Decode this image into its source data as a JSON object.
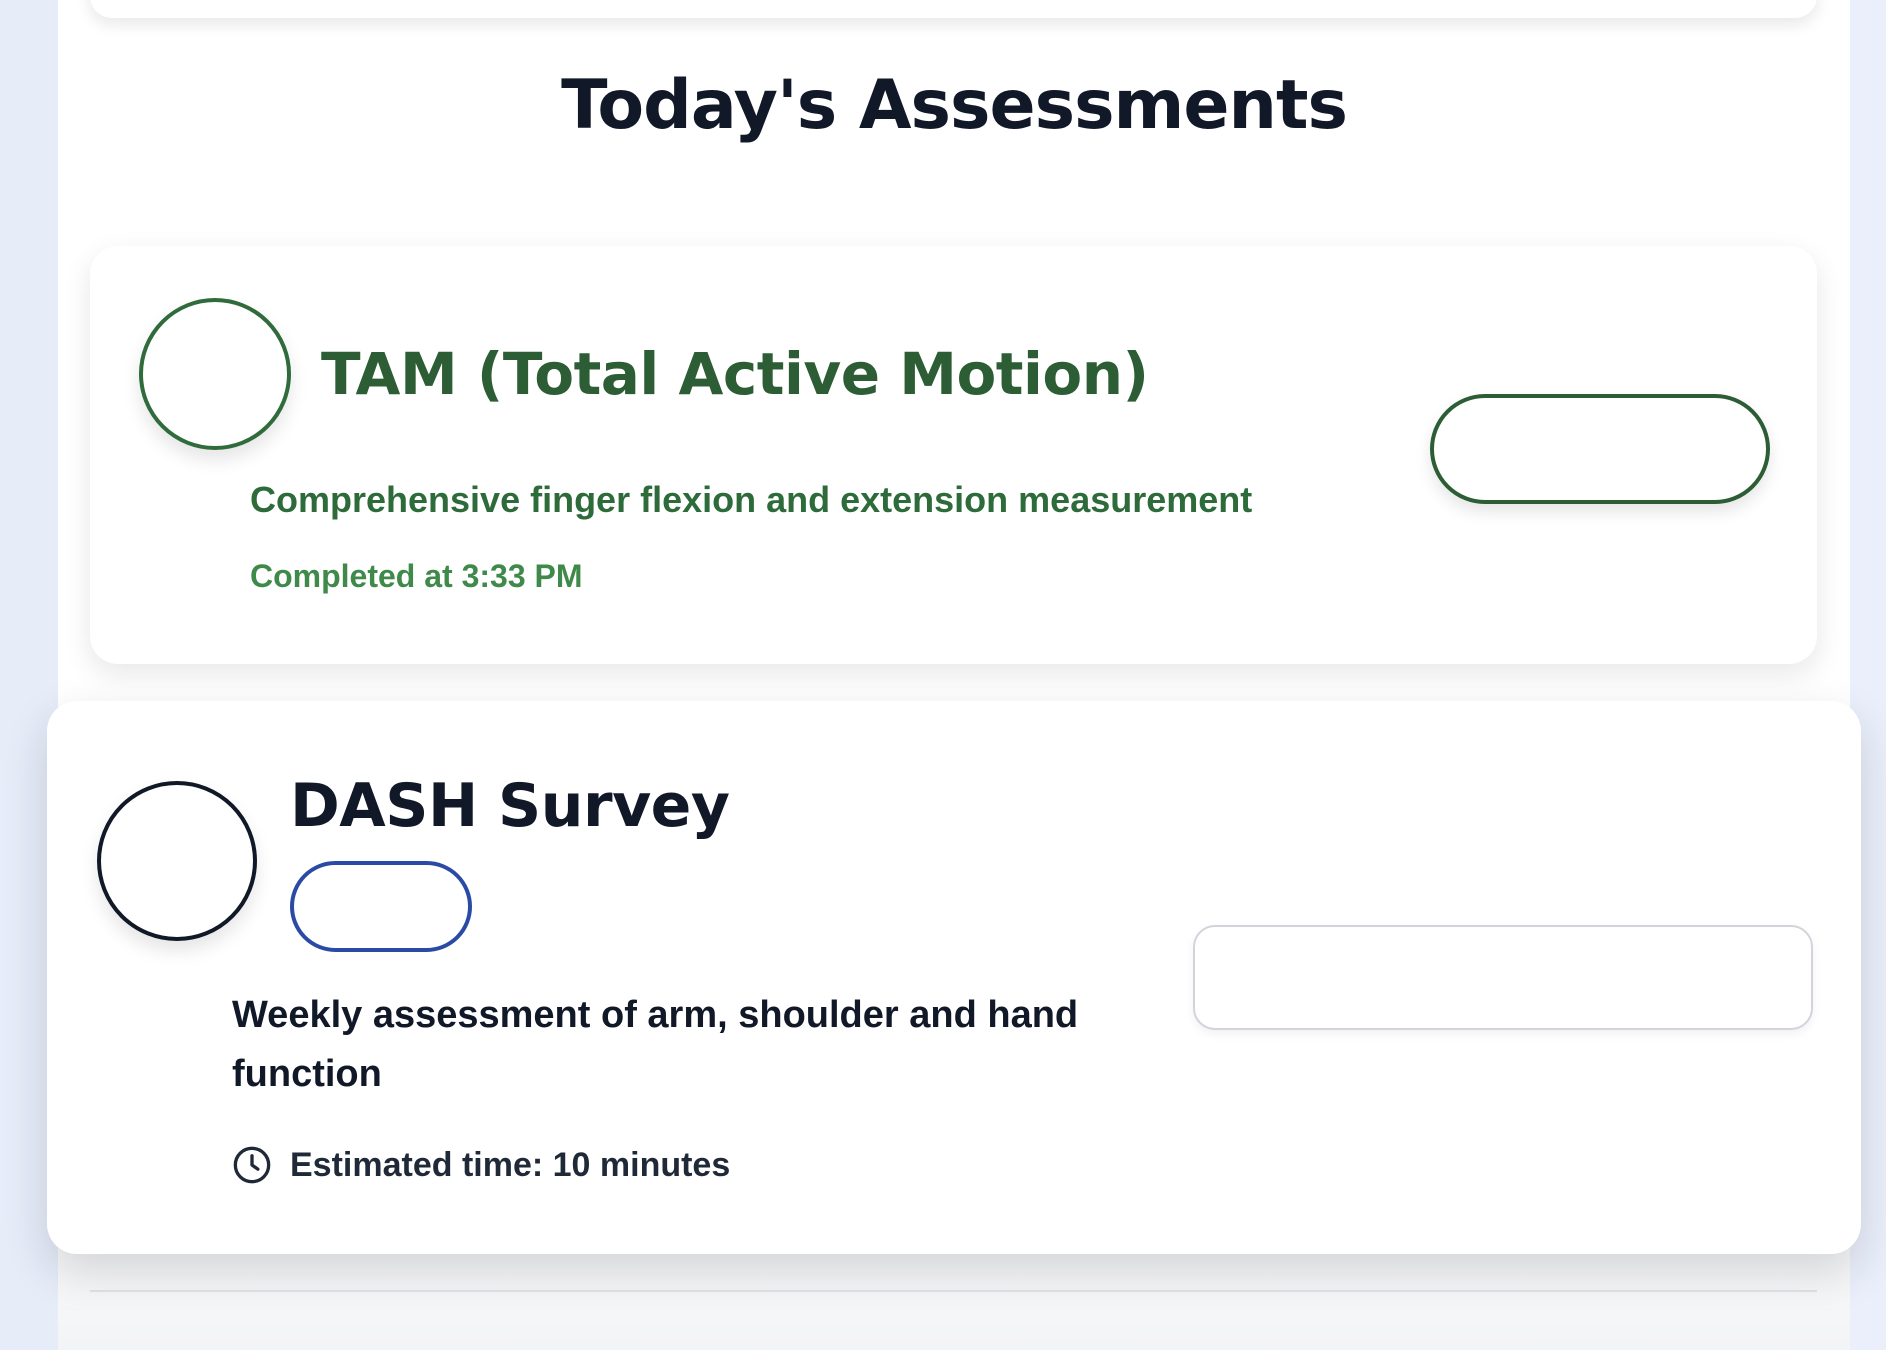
{
  "page": {
    "title": "Today's Assessments"
  },
  "assessments": [
    {
      "name": "TAM (Total Active Motion)",
      "description": "Comprehensive finger flexion and extension measurement",
      "status_text": "Completed at 3:33 PM",
      "status": "completed",
      "accent_color": "#2c5d34",
      "action_label": ""
    },
    {
      "name": "DASH Survey",
      "description": "Weekly assessment of arm, shoulder and hand function",
      "badge_label": "",
      "estimated_time_label": "Estimated time: 10 minutes",
      "status": "pending",
      "badge_color": "#2a4aa6",
      "time_icon": "clock-icon",
      "action_label": ""
    }
  ]
}
